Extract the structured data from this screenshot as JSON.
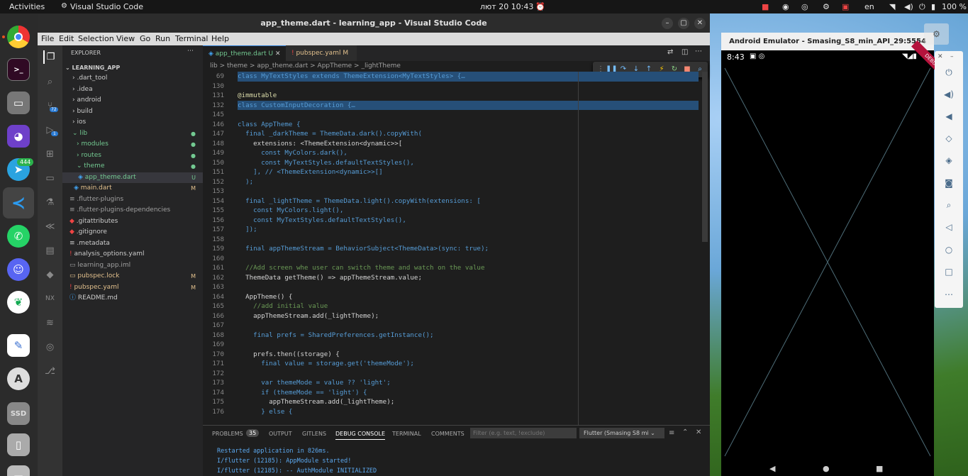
{
  "topbar": {
    "activities": "Activities",
    "app": "Visual Studio Code",
    "clock": "лют 20  10:43",
    "lang": "en",
    "battery": "100 %"
  },
  "dock": {
    "telegram_badge": "444"
  },
  "vscode": {
    "title": "app_theme.dart - learning_app - Visual Studio Code",
    "menu": [
      "File",
      "Edit",
      "Selection",
      "View",
      "Go",
      "Run",
      "Terminal",
      "Help"
    ],
    "activity": {
      "scm_badge": "72",
      "debug_badge": "1"
    },
    "explorer": {
      "header": "EXPLORER",
      "root": "LEARNING_APP",
      "items": [
        {
          "label": ".dart_tool",
          "badge": ""
        },
        {
          "label": ".idea",
          "badge": ""
        },
        {
          "label": "android",
          "badge": ""
        },
        {
          "label": "build",
          "badge": ""
        },
        {
          "label": "ios",
          "badge": ""
        },
        {
          "label": "lib",
          "badge": ""
        },
        {
          "label": "modules",
          "badge": ""
        },
        {
          "label": "routes",
          "badge": ""
        },
        {
          "label": "theme",
          "badge": ""
        },
        {
          "label": "app_theme.dart",
          "badge": "U"
        },
        {
          "label": "main.dart",
          "badge": "M"
        },
        {
          "label": ".flutter-plugins",
          "badge": ""
        },
        {
          "label": ".flutter-plugins-dependencies",
          "badge": ""
        },
        {
          "label": ".gitattributes",
          "badge": ""
        },
        {
          "label": ".gitignore",
          "badge": ""
        },
        {
          "label": ".metadata",
          "badge": ""
        },
        {
          "label": "analysis_options.yaml",
          "badge": ""
        },
        {
          "label": "learning_app.iml",
          "badge": ""
        },
        {
          "label": "pubspec.lock",
          "badge": "M"
        },
        {
          "label": "pubspec.yaml",
          "badge": "M"
        },
        {
          "label": "README.md",
          "badge": ""
        }
      ]
    },
    "tabs": [
      {
        "label": "app_theme.dart",
        "state": "U"
      },
      {
        "label": "pubspec.yaml",
        "state": "M"
      }
    ],
    "breadcrumbs": [
      "lib",
      ">",
      "theme",
      ">",
      "app_theme.dart",
      ">",
      "AppTheme",
      ">",
      "_lightTheme"
    ],
    "code": [
      {
        "n": "69",
        "t": "class MyTextStyles extends ThemeExtension<MyTextStyles> {…"
      },
      {
        "n": "130",
        "t": ""
      },
      {
        "n": "131",
        "t": "@immutable"
      },
      {
        "n": "132",
        "t": "class CustomInputDecoration {…"
      },
      {
        "n": "145",
        "t": ""
      },
      {
        "n": "146",
        "t": "class AppTheme {"
      },
      {
        "n": "147",
        "t": "  final _darkTheme = ThemeData.dark().copyWith("
      },
      {
        "n": "148",
        "t": "    extensions: <ThemeExtension<dynamic>>["
      },
      {
        "n": "149",
        "t": "      const MyColors.dark(),"
      },
      {
        "n": "150",
        "t": "      const MyTextStyles.defaultTextStyles(),"
      },
      {
        "n": "151",
        "t": "    ], // <ThemeExtension<dynamic>>[]"
      },
      {
        "n": "152",
        "t": "  );"
      },
      {
        "n": "153",
        "t": ""
      },
      {
        "n": "154",
        "t": "  final _lightTheme = ThemeData.light().copyWith(extensions: ["
      },
      {
        "n": "155",
        "t": "    const MyColors.light(),"
      },
      {
        "n": "156",
        "t": "    const MyTextStyles.defaultTextStyles(),"
      },
      {
        "n": "157",
        "t": "  ]);"
      },
      {
        "n": "158",
        "t": ""
      },
      {
        "n": "159",
        "t": "  final appThemeStream = BehaviorSubject<ThemeData>(sync: true);"
      },
      {
        "n": "160",
        "t": ""
      },
      {
        "n": "161",
        "t": "  //Add screen whe user can switch theme and watch on the value"
      },
      {
        "n": "162",
        "t": "  ThemeData getTheme() => appThemeStream.value;"
      },
      {
        "n": "163",
        "t": ""
      },
      {
        "n": "164",
        "t": "  AppTheme() {"
      },
      {
        "n": "165",
        "t": "    //add initial value"
      },
      {
        "n": "166",
        "t": "    appThemeStream.add(_lightTheme);"
      },
      {
        "n": "167",
        "t": ""
      },
      {
        "n": "168",
        "t": "    final prefs = SharedPreferences.getInstance();"
      },
      {
        "n": "169",
        "t": ""
      },
      {
        "n": "170",
        "t": "    prefs.then((storage) {"
      },
      {
        "n": "171",
        "t": "      final value = storage.get('themeMode');"
      },
      {
        "n": "172",
        "t": ""
      },
      {
        "n": "173",
        "t": "      var themeMode = value ?? 'light';"
      },
      {
        "n": "174",
        "t": "      if (themeMode == 'light') {"
      },
      {
        "n": "175",
        "t": "        appThemeStream.add(_lightTheme);"
      },
      {
        "n": "176",
        "t": "      } else {"
      }
    ],
    "panel": {
      "tabs": [
        "PROBLEMS",
        "OUTPUT",
        "GITLENS",
        "DEBUG CONSOLE",
        "TERMINAL",
        "COMMENTS"
      ],
      "problems_count": "35",
      "filter_placeholder": "Filter (e.g. text, !exclude)",
      "device": "Flutter (Smasing S8 mi",
      "output": [
        "Restarted application in 826ms.",
        "I/flutter (12185): AppModule started!",
        "I/flutter (12185): -- AuthModule INITIALIZED"
      ]
    }
  },
  "emulator": {
    "title": "Android Emulator - Smasing_S8_min_API_29:5554",
    "time": "8:43",
    "debug_ribbon": "DEBUG"
  }
}
